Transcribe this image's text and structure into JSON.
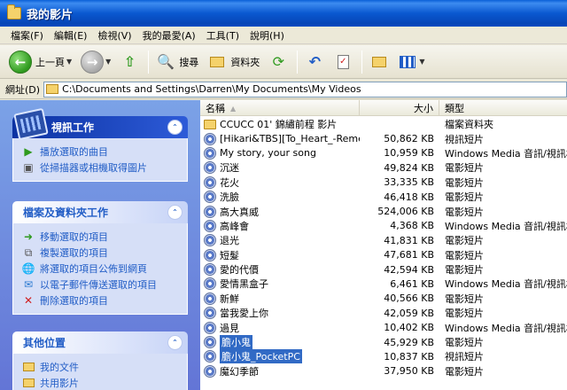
{
  "window": {
    "title": "我的影片"
  },
  "menu": [
    "檔案(F)",
    "編輯(E)",
    "檢視(V)",
    "我的最愛(A)",
    "工具(T)",
    "說明(H)"
  ],
  "toolbar": {
    "back_label": "上一頁",
    "search_label": "搜尋",
    "folders_label": "資料夾"
  },
  "address": {
    "label": "網址(D)",
    "path": "C:\\Documents and Settings\\Darren\\My Documents\\My Videos"
  },
  "taskpane": {
    "video_tasks": {
      "title": "視訊工作",
      "items": [
        "播放選取的曲目",
        "從掃描器或相機取得圖片"
      ]
    },
    "file_tasks": {
      "title": "檔案及資料夾工作",
      "items": [
        "移動選取的項目",
        "複製選取的項目",
        "將選取的項目公佈到網頁",
        "以電子郵件傳送選取的項目",
        "刪除選取的項目"
      ]
    },
    "other_places": {
      "title": "其他位置",
      "items": [
        "我的文件",
        "共用影片"
      ]
    }
  },
  "columns": {
    "name": "名稱",
    "size": "大小",
    "type": "類型"
  },
  "files": [
    {
      "name": "CCUCC 01' 錦繡前程 影片",
      "size": "",
      "type": "檔案資料夾",
      "icon": "folder-icon",
      "selected": false
    },
    {
      "name": "[Hikari&TBS][To_Heart_-Reme...",
      "size": "50,862 KB",
      "type": "視訊短片",
      "icon": "media-file-icon",
      "selected": false
    },
    {
      "name": "My story, your song",
      "size": "10,959 KB",
      "type": "Windows Media 音訊/視訊檔",
      "icon": "media-file-icon",
      "selected": false
    },
    {
      "name": "沉迷",
      "size": "49,824 KB",
      "type": "電影短片",
      "icon": "media-file-icon",
      "selected": false
    },
    {
      "name": "花火",
      "size": "33,335 KB",
      "type": "電影短片",
      "icon": "media-file-icon",
      "selected": false
    },
    {
      "name": "洗臉",
      "size": "46,418 KB",
      "type": "電影短片",
      "icon": "media-file-icon",
      "selected": false
    },
    {
      "name": "高大真威",
      "size": "524,006 KB",
      "type": "電影短片",
      "icon": "media-file-icon",
      "selected": false
    },
    {
      "name": "高峰會",
      "size": "4,368 KB",
      "type": "Windows Media 音訊/視訊檔",
      "icon": "media-file-icon",
      "selected": false
    },
    {
      "name": "退光",
      "size": "41,831 KB",
      "type": "電影短片",
      "icon": "media-file-icon",
      "selected": false
    },
    {
      "name": "短髮",
      "size": "47,681 KB",
      "type": "電影短片",
      "icon": "media-file-icon",
      "selected": false
    },
    {
      "name": "愛的代價",
      "size": "42,594 KB",
      "type": "電影短片",
      "icon": "media-file-icon",
      "selected": false
    },
    {
      "name": "愛情黑盒子",
      "size": "6,461 KB",
      "type": "Windows Media 音訊/視訊檔",
      "icon": "media-file-icon",
      "selected": false
    },
    {
      "name": "新鮮",
      "size": "40,566 KB",
      "type": "電影短片",
      "icon": "media-file-icon",
      "selected": false
    },
    {
      "name": "當我愛上你",
      "size": "42,059 KB",
      "type": "電影短片",
      "icon": "media-file-icon",
      "selected": false
    },
    {
      "name": "過見",
      "size": "10,402 KB",
      "type": "Windows Media 音訊/視訊檔",
      "icon": "media-file-icon",
      "selected": false
    },
    {
      "name": "膽小鬼",
      "size": "45,929 KB",
      "type": "電影短片",
      "icon": "media-file-icon",
      "selected": true
    },
    {
      "name": "膽小鬼_PocketPC",
      "size": "10,837 KB",
      "type": "視訊短片",
      "icon": "media-file-icon",
      "selected": true
    },
    {
      "name": "魔幻季節",
      "size": "37,950 KB",
      "type": "電影短片",
      "icon": "media-file-icon",
      "selected": false
    }
  ]
}
